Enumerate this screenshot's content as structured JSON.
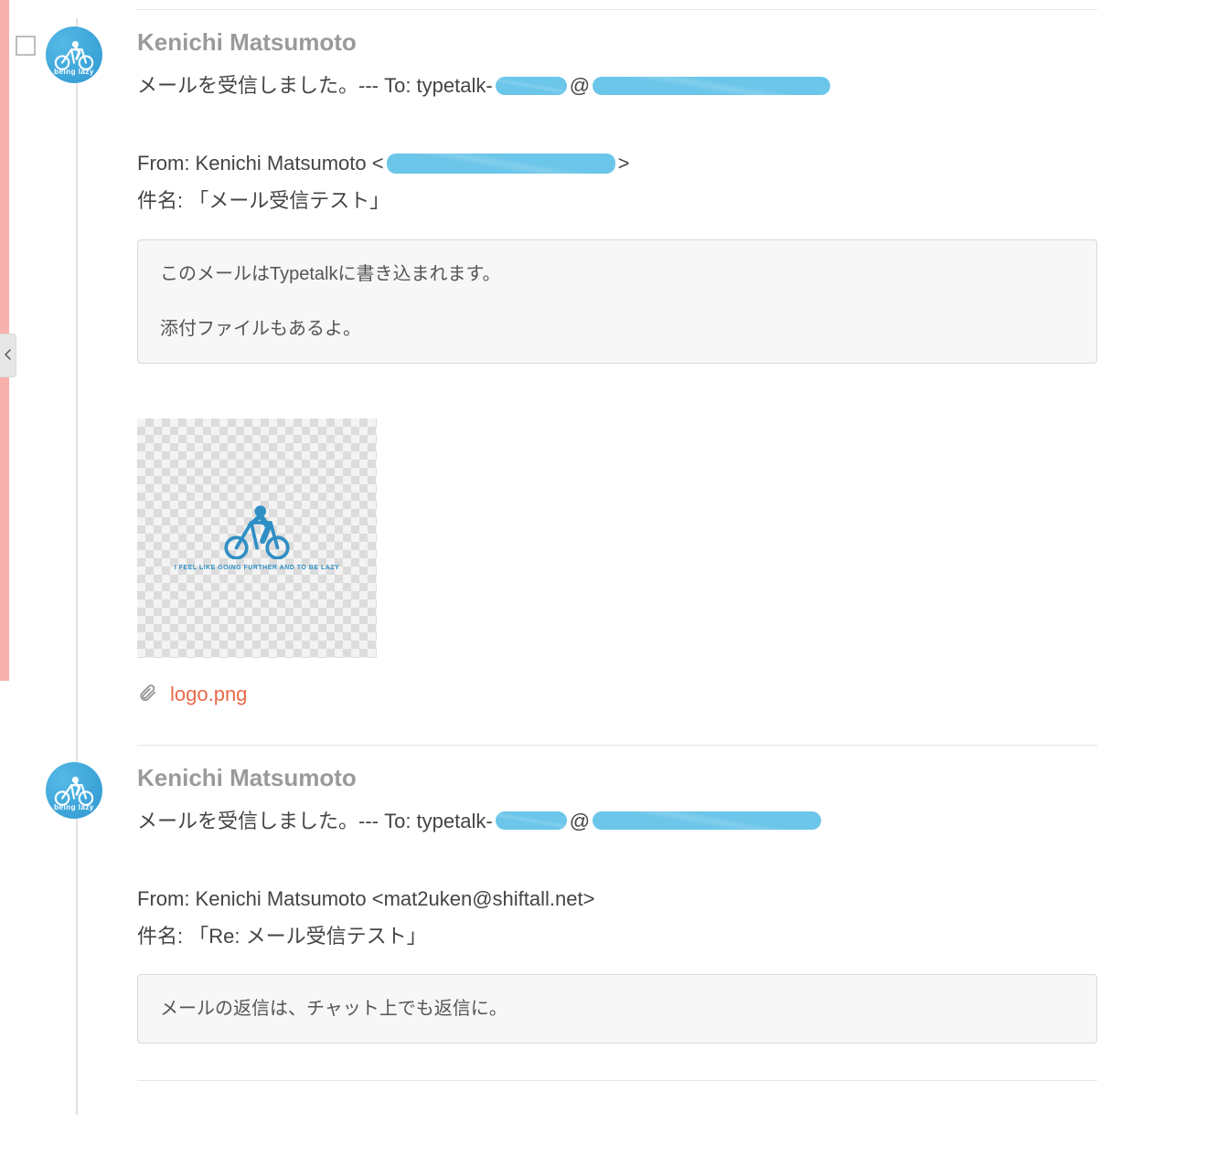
{
  "colors": {
    "accent": "#f7b0ab",
    "avatar": "#3aa6dc",
    "redaction": "#6cc6ea",
    "attachment_link": "#e86a4a"
  },
  "avatar_label": "being lazy",
  "thumbnail_caption": "I FEEL LIKE GOING FURTHER AND TO BE LAZY",
  "messages": [
    {
      "author": "Kenichi Matsumoto",
      "received_prefix": "メールを受信しました。--- To: typetalk-",
      "at_symbol": "@",
      "from_prefix": "From: Kenichi Matsumoto <",
      "from_suffix": ">",
      "subject_label": "件名:",
      "subject_value": "「メール受信テスト」",
      "quote_line1": "このメールはTypetalkに書き込まれます。",
      "quote_line2": "添付ファイルもあるよ。",
      "attachment": "logo.png",
      "has_checkbox": true,
      "has_thumbnail": true
    },
    {
      "author": "Kenichi Matsumoto",
      "received_prefix": "メールを受信しました。--- To: typetalk-",
      "at_symbol": "@",
      "from_full": "From: Kenichi Matsumoto <mat2uken@shiftall.net>",
      "subject_label": "件名:",
      "subject_value": "「Re: メール受信テスト」",
      "quote_line1": "メールの返信は、チャット上でも返信に。",
      "has_checkbox": false,
      "has_thumbnail": false
    }
  ]
}
